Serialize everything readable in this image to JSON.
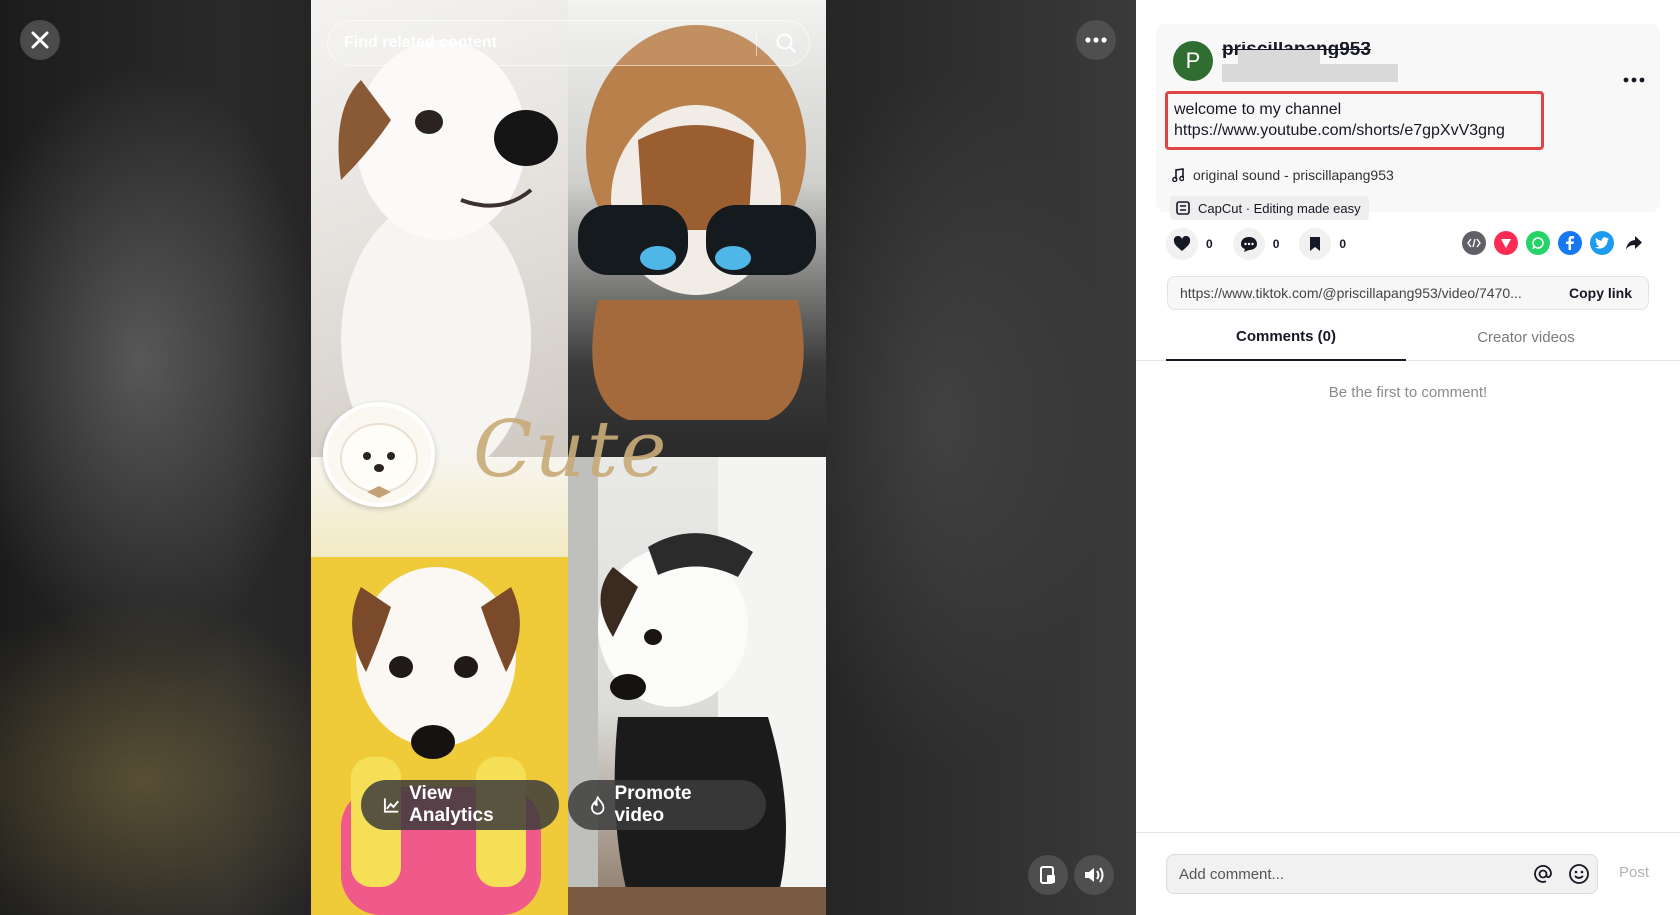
{
  "player": {
    "search_placeholder": "Find related content",
    "overlay_text": "Cute",
    "buttons": {
      "analytics": "View Analytics",
      "promote": "Promote video"
    }
  },
  "post": {
    "avatar_letter": "P",
    "username": "priscillapang953",
    "description_line1": "welcome to my channel",
    "description_line2": "https://www.youtube.com/shorts/e7gpXvV3gng",
    "sound": "original sound - priscillapang953",
    "capcut": "CapCut · Editing made easy"
  },
  "stats": {
    "likes": "0",
    "comments": "0",
    "saves": "0"
  },
  "share_icons": [
    "embed-icon",
    "send-icon",
    "whatsapp-icon",
    "facebook-icon",
    "twitter-icon",
    "share-arrow-icon"
  ],
  "link": {
    "url": "https://www.tiktok.com/@priscillapang953/video/7470...",
    "copy_label": "Copy link"
  },
  "tabs": {
    "comments": "Comments (0)",
    "creator": "Creator videos"
  },
  "empty_message": "Be the first to comment!",
  "composer": {
    "placeholder": "Add comment...",
    "post_label": "Post"
  },
  "colors": {
    "avatar": "#2f6d31",
    "highlight_border": "#e04545",
    "whatsapp": "#25d366",
    "facebook": "#1877f2",
    "twitter": "#1d9bf0",
    "send": "#fe2c55"
  }
}
